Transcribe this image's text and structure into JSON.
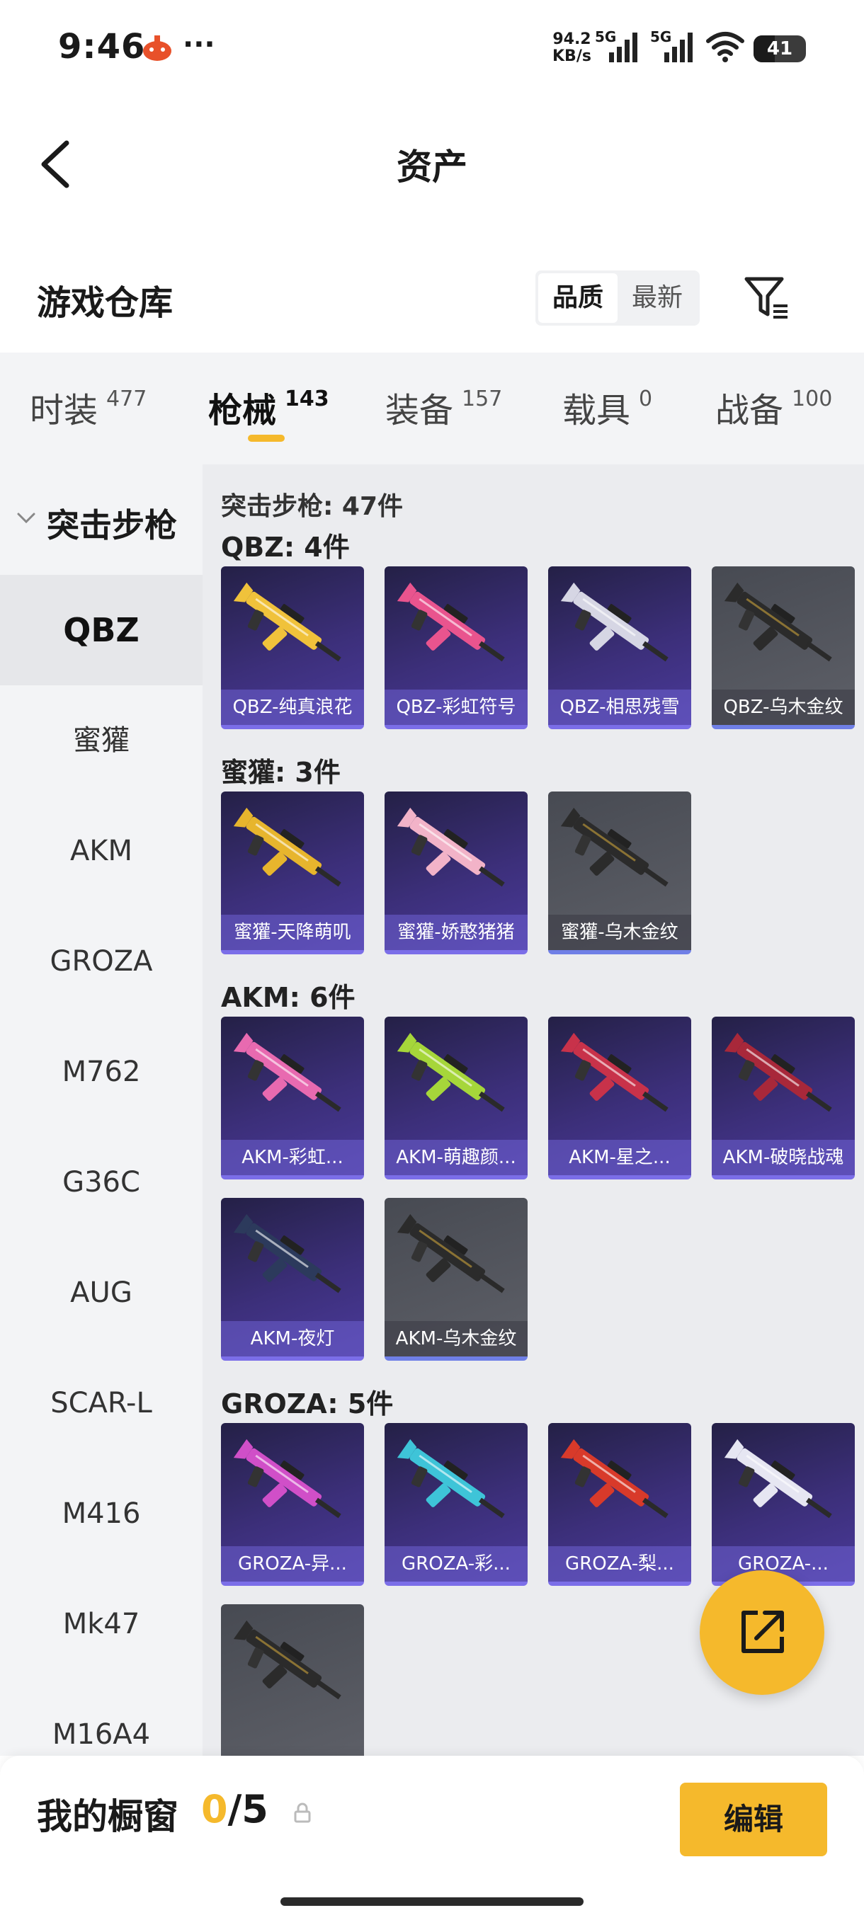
{
  "status_bar": {
    "time": "9:46",
    "speed_value": "94.2",
    "speed_unit": "KB/s",
    "net1": "5G",
    "net2": "5G",
    "battery": "41"
  },
  "header": {
    "title": "资产"
  },
  "section": {
    "title": "游戏仓库",
    "sort_options": [
      "品质",
      "最新"
    ],
    "sort_active": 0
  },
  "tabs": [
    {
      "label": "时装",
      "count": "477"
    },
    {
      "label": "枪械",
      "count": "143"
    },
    {
      "label": "装备",
      "count": "157"
    },
    {
      "label": "载具",
      "count": "0"
    },
    {
      "label": "战备",
      "count": "100"
    }
  ],
  "active_tab": 1,
  "sidebar": {
    "category": "突击步枪",
    "items": [
      "QBZ",
      "蜜獾",
      "AKM",
      "GROZA",
      "M762",
      "G36C",
      "AUG",
      "SCAR-L",
      "M416",
      "Mk47",
      "M16A4"
    ],
    "active_index": 0
  },
  "content": {
    "total": "突击步枪: 47件",
    "groups": [
      {
        "title": "QBZ: 4件",
        "items": [
          {
            "name": "QBZ-纯真浪花",
            "style": "purple",
            "color": "#f0c23b"
          },
          {
            "name": "QBZ-彩虹符号",
            "style": "purple",
            "color": "#e9548e"
          },
          {
            "name": "QBZ-相思残雪",
            "style": "purple",
            "color": "#d6d6e4"
          },
          {
            "name": "QBZ-乌木金纹",
            "style": "gray",
            "color": "#2b2b2b"
          }
        ]
      },
      {
        "title": "蜜獾: 3件",
        "items": [
          {
            "name": "蜜獾-天降萌叽",
            "style": "purple",
            "color": "#e7b52d"
          },
          {
            "name": "蜜獾-娇憨猪猪",
            "style": "purple",
            "color": "#f2b3c8"
          },
          {
            "name": "蜜獾-乌木金纹",
            "style": "gray",
            "color": "#2b2b2b"
          }
        ]
      },
      {
        "title": "AKM: 6件",
        "items": [
          {
            "name": "AKM-彩虹...",
            "style": "purple",
            "color": "#e86ab0"
          },
          {
            "name": "AKM-萌趣颜...",
            "style": "purple",
            "color": "#a6d63a"
          },
          {
            "name": "AKM-星之...",
            "style": "purple",
            "color": "#c8324a"
          },
          {
            "name": "AKM-破晓战魂",
            "style": "purple",
            "color": "#a8283a"
          },
          {
            "name": "AKM-夜灯",
            "style": "purple",
            "color": "#2c3a5c"
          },
          {
            "name": "AKM-乌木金纹",
            "style": "gray",
            "color": "#2b2b2b"
          }
        ]
      },
      {
        "title": "GROZA: 5件",
        "items": [
          {
            "name": "GROZA-异...",
            "style": "purple",
            "color": "#d04fc8"
          },
          {
            "name": "GROZA-彩...",
            "style": "purple",
            "color": "#3ec4d8"
          },
          {
            "name": "GROZA-梨...",
            "style": "purple",
            "color": "#d83a2a"
          },
          {
            "name": "GROZA-...",
            "style": "purple",
            "color": "#e6e6f2"
          },
          {
            "name": "",
            "style": "gray",
            "color": "#2b2b2b"
          }
        ]
      }
    ]
  },
  "bottom": {
    "label": "我的橱窗",
    "current": "0",
    "max": "/5",
    "edit_label": "编辑"
  }
}
